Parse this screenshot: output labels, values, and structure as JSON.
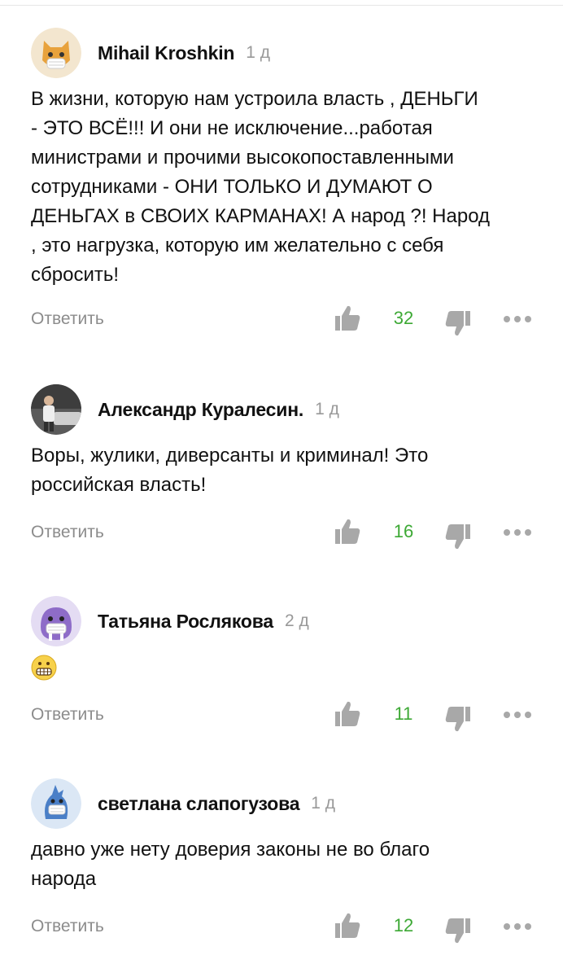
{
  "comments": [
    {
      "author": "Mihail Kroshkin",
      "time": "1 д",
      "avatar_icon": "cat-mask-avatar-icon",
      "text": "В жизни, которую нам устроила власть , ДЕНЬГИ\n- ЭТО ВСЁ!!! И они не исключение...работая\nминистрами и прочими высокопоставленными\nсотрудниками - ОНИ ТОЛЬКО И ДУМАЮТ О\nДЕНЬГАХ в СВОИХ КАРМАНАХ! А народ ?! Народ\n, это нагрузка, которую им желательно с себя\nсбросить!",
      "reply_label": "Ответить",
      "likes": "32"
    },
    {
      "author": "Александр Куралесин.",
      "time": "1 д",
      "avatar_icon": "photo-avatar",
      "text": "Воры, жулики, диверсанты и криминал! Это\nроссийская власть!",
      "reply_label": "Ответить",
      "likes": "16"
    },
    {
      "author": "Татьяна Рослякова",
      "time": "2 д",
      "avatar_icon": "walrus-mask-avatar-icon",
      "text": "",
      "emoji": "grimacing-face-emoji",
      "reply_label": "Ответить",
      "likes": "11"
    },
    {
      "author": "светлана слапогузова",
      "time": "1 д",
      "avatar_icon": "bird-mask-avatar-icon",
      "text": "давно уже нету доверия законы не во благо\nнарода",
      "reply_label": "Ответить",
      "likes": "12"
    }
  ],
  "colors": {
    "like_count": "#3da935",
    "muted_text": "#8c8c8c",
    "icon_gray": "#a8a8a8"
  }
}
